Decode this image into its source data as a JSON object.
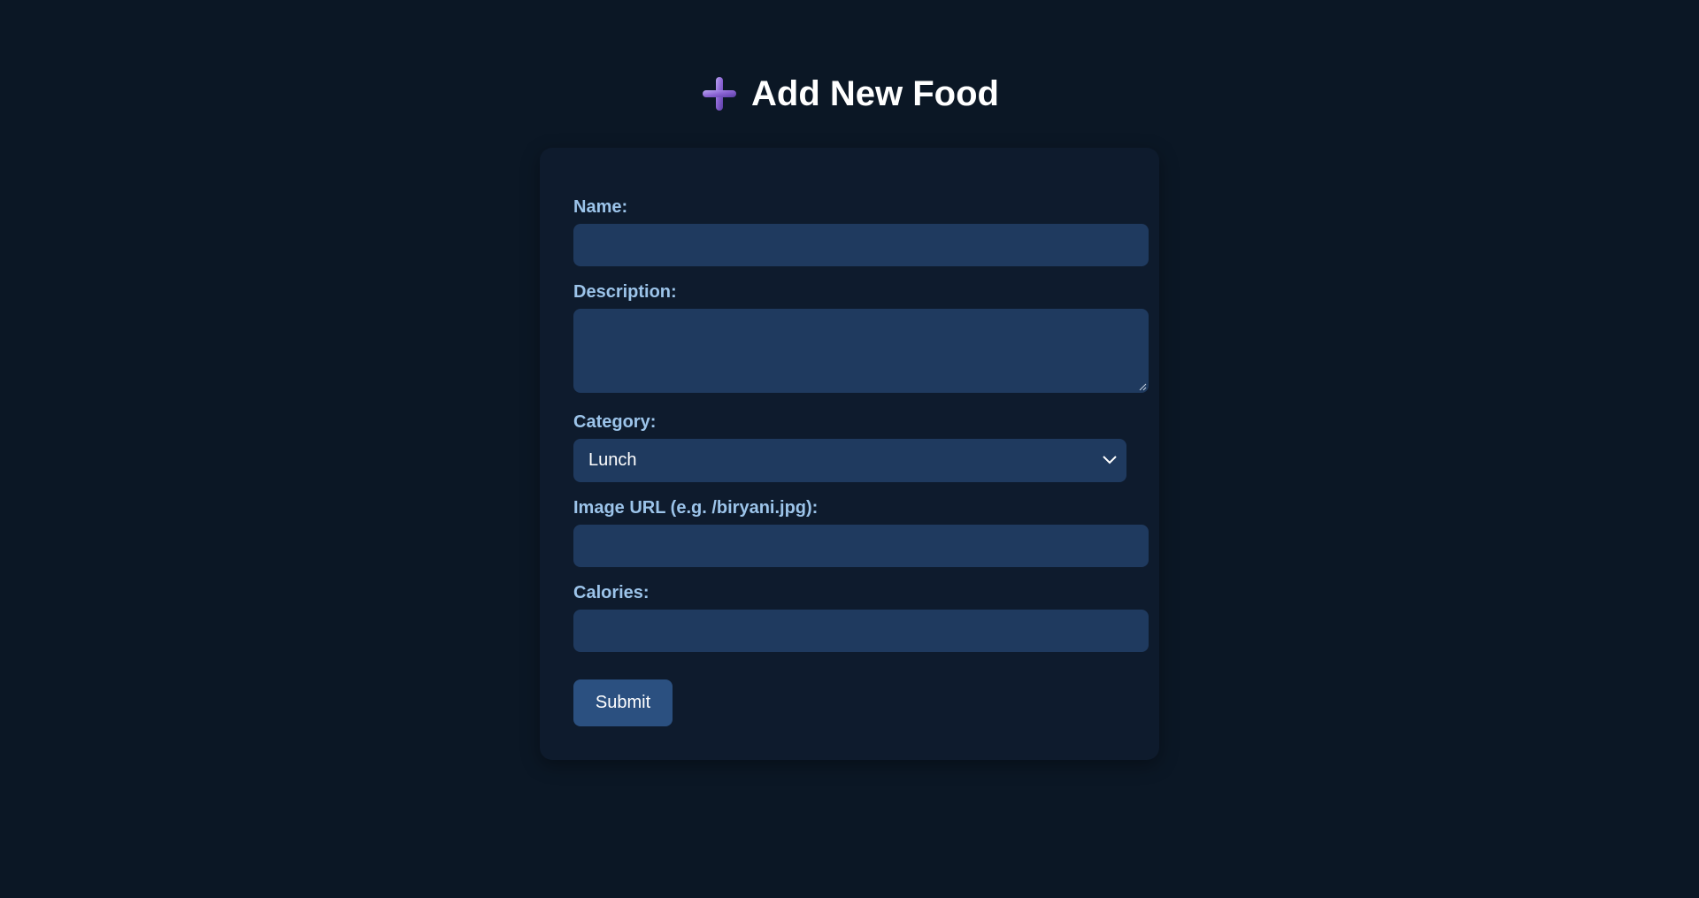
{
  "header": {
    "icon": "plus-icon",
    "title": "Add New Food"
  },
  "form": {
    "name_label": "Name:",
    "name_value": "",
    "description_label": "Description:",
    "description_value": "",
    "category_label": "Category:",
    "category_value": "Lunch",
    "image_url_label": "Image URL (e.g. /biryani.jpg):",
    "image_url_value": "",
    "calories_label": "Calories:",
    "calories_value": "",
    "submit_label": "Submit"
  },
  "colors": {
    "background": "#0b1725",
    "card": "#0e1b2d",
    "input": "#1f3a5f",
    "label": "#9cc4ea",
    "button": "#2b5080",
    "icon": "#8a63d2"
  }
}
